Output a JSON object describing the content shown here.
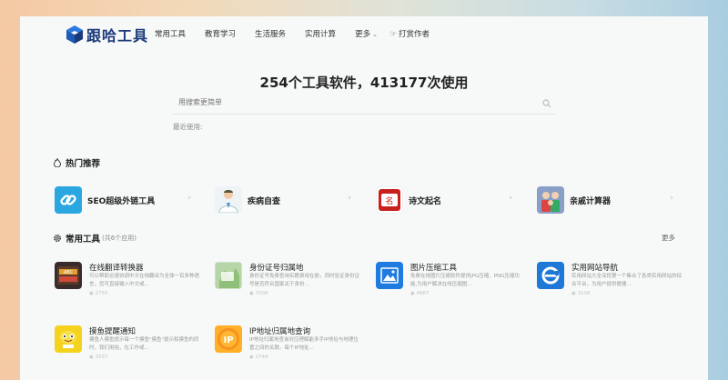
{
  "header": {
    "logo_text": "跟哈工具",
    "nav": [
      {
        "label": "常用工具"
      },
      {
        "label": "教育学习"
      },
      {
        "label": "生活服务"
      },
      {
        "label": "实用计算"
      }
    ],
    "more_label": "更多",
    "donate_label": "打赏作者"
  },
  "hero": {
    "title": "254个工具软件，413177次使用",
    "search_placeholder": "用搜索更简单",
    "recent_label": "最近使用:"
  },
  "hot": {
    "section_title": "热门推荐",
    "items": [
      {
        "name": "SEO超级外链工具",
        "icon": "link-icon"
      },
      {
        "name": "疾病自查",
        "icon": "doctor-icon"
      },
      {
        "name": "诗文起名",
        "icon": "name-seal-icon"
      },
      {
        "name": "亲戚计算器",
        "icon": "family-icon"
      }
    ]
  },
  "common": {
    "section_title": "常用工具",
    "count_label": "(共6个应用)",
    "more_label": "更多",
    "tools": [
      {
        "name": "在线翻译转换器",
        "desc": "可以帮助迅速协调中文在线翻译为全球一百多种语言，您可直接输入中文或...",
        "views": "2755",
        "icon": "translator-icon"
      },
      {
        "name": "身份证号归属地",
        "desc": "身份证号免费查询实籍费用在册，同时验证身份证号是否符合国家关于身份...",
        "views": "7008",
        "icon": "id-card-map-icon"
      },
      {
        "name": "图片压缩工具",
        "desc": "免费在线图片压缩软件提供JPG压缩、PNG压缩功能,为用户解决在线压缩图...",
        "views": "4987",
        "icon": "image-compress-icon"
      },
      {
        "name": "实用网站导航",
        "desc": "实用网站大全深挖第一个集合了各类实用网站的综合平台，为用户提供便捷...",
        "views": "3108",
        "icon": "ie-icon"
      },
      {
        "name": "摸鱼提醒通知",
        "desc": "摸鱼人摸鱼提示每一个摸鱼\"摸鱼\"提示和摸鱼的同时，我们用抬，在工作或...",
        "views": "2567",
        "icon": "fish-icon"
      },
      {
        "name": "IP地址归属地查询",
        "desc": "IP地址归属地查询对应理解能多手IP地址与地理位置之间的关联。每个IP地址...",
        "views": "2744",
        "icon": "ip-icon"
      }
    ]
  },
  "colors": {
    "brand": "#1a3a7a",
    "accent": "#2d7be0"
  }
}
